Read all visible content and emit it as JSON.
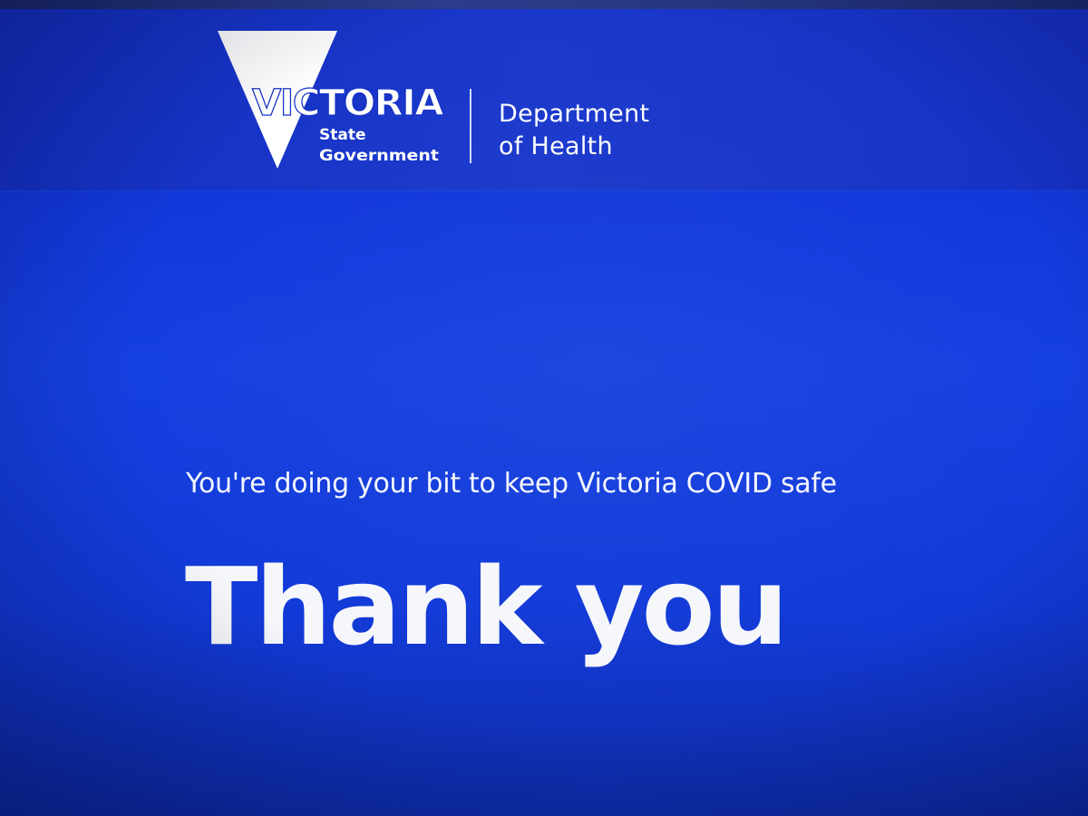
{
  "brand": {
    "logo_word": "VICTORIA",
    "logo_line1": "State",
    "logo_line2": "Government",
    "logo_icon": "victoria-v-triangle-icon",
    "dept_line1": "Department",
    "dept_line2": "of Health"
  },
  "message": {
    "tagline": "You're doing your bit to keep Victoria COVID safe",
    "headline": "Thank you"
  },
  "colors": {
    "background": "#1540e0",
    "header": "#1632c6",
    "text": "#ffffff"
  }
}
